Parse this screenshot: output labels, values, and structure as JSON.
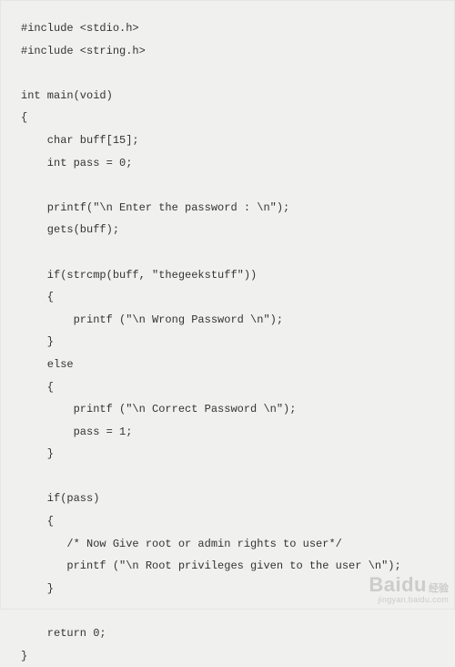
{
  "code_lines": [
    "#include <stdio.h>",
    "#include <string.h>",
    "",
    "int main(void)",
    "{",
    "    char buff[15];",
    "    int pass = 0;",
    "",
    "    printf(\"\\n Enter the password : \\n\");",
    "    gets(buff);",
    "",
    "    if(strcmp(buff, \"thegeekstuff\"))",
    "    {",
    "        printf (\"\\n Wrong Password \\n\");",
    "    }",
    "    else",
    "    {",
    "        printf (\"\\n Correct Password \\n\");",
    "        pass = 1;",
    "    }",
    "",
    "    if(pass)",
    "    {",
    "       /* Now Give root or admin rights to user*/",
    "       printf (\"\\n Root privileges given to the user \\n\");",
    "    }",
    "",
    "    return 0;",
    "}"
  ],
  "watermark": {
    "brand": "Baidu",
    "cn": "经验",
    "sub": "jingyan.baidu.com"
  }
}
